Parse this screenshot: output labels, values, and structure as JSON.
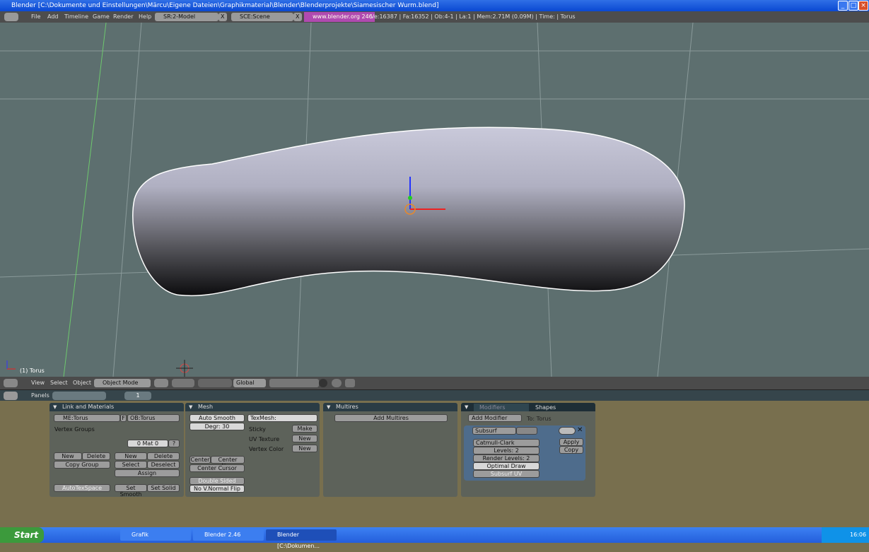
{
  "window": {
    "title": "Blender [C:\\Dokumente und Einstellungen\\Märcu\\Eigene Dateien\\Graphikmaterial\\Blender\\Blenderprojekte\\Siamesischer Wurm.blend]",
    "controls": [
      "_",
      "□",
      "×"
    ]
  },
  "topbar": {
    "menus": [
      "File",
      "Add",
      "Timeline",
      "Game",
      "Render",
      "Help"
    ],
    "screen": "SR:2-Model",
    "scene": "SCE:Scene",
    "close": "X",
    "link": "www.blender.org 246",
    "stats": "Ve:16387 | Fa:16352 | Ob:4-1 | La:1  | Mem:2.71M (0.09M)  | Time: | Torus"
  },
  "viewport": {
    "object_label": "(1) Torus",
    "colors": {
      "background": "#5d6f6f",
      "mesh": "#a9a9bd"
    }
  },
  "header3d": {
    "menus": [
      "View",
      "Select",
      "Object"
    ],
    "mode": "Object Mode",
    "orientation": "Global"
  },
  "buttons_header": {
    "panels_label": "Panels",
    "frame": "1"
  },
  "link_materials": {
    "title": "Link and Materials",
    "mesh": "ME:Torus",
    "f": "F",
    "object": "OB:Torus",
    "vertex_groups": "Vertex Groups",
    "mat": "0 Mat 0",
    "q": "?",
    "new1": "New",
    "delete1": "Delete",
    "copy_group": "Copy Group",
    "new2": "New",
    "delete2": "Delete",
    "select": "Select",
    "deselect": "Deselect",
    "assign": "Assign",
    "autotexspace": "AutoTexSpace",
    "set_smooth": "Set Smooth",
    "set_solid": "Set Solid"
  },
  "mesh": {
    "title": "Mesh",
    "auto_smooth": "Auto Smooth",
    "degr": "Degr: 30",
    "texmesh": "TexMesh:",
    "sticky": "Sticky",
    "make": "Make",
    "uv_texture": "UV Texture",
    "new_uv": "New",
    "vertex_color": "Vertex Color",
    "new_vc": "New",
    "center": "Center",
    "center_new": "Center New",
    "center_cursor": "Center Cursor",
    "double_sided": "Double Sided",
    "no_vnormal_flip": "No V.Normal Flip"
  },
  "multires": {
    "title": "Multires",
    "add": "Add Multires"
  },
  "modifiers": {
    "tab_modifiers": "Modifiers",
    "tab_shapes": "Shapes",
    "add_modifier": "Add Modifier",
    "to": "To: Torus",
    "name": "Subsurf",
    "type": "Catmull-Clark",
    "levels": "Levels: 2",
    "render_levels": "Render Levels: 2",
    "optimal_draw": "Optimal Draw",
    "subsurf_uv": "Subsurf UV",
    "apply": "Apply",
    "copy": "Copy",
    "close": "✕"
  },
  "taskbar": {
    "start": "Start",
    "tasks": [
      "Grafik",
      "Blender 2.46",
      "Blender [C:\\Dokumen..."
    ],
    "clock": "16:06"
  }
}
